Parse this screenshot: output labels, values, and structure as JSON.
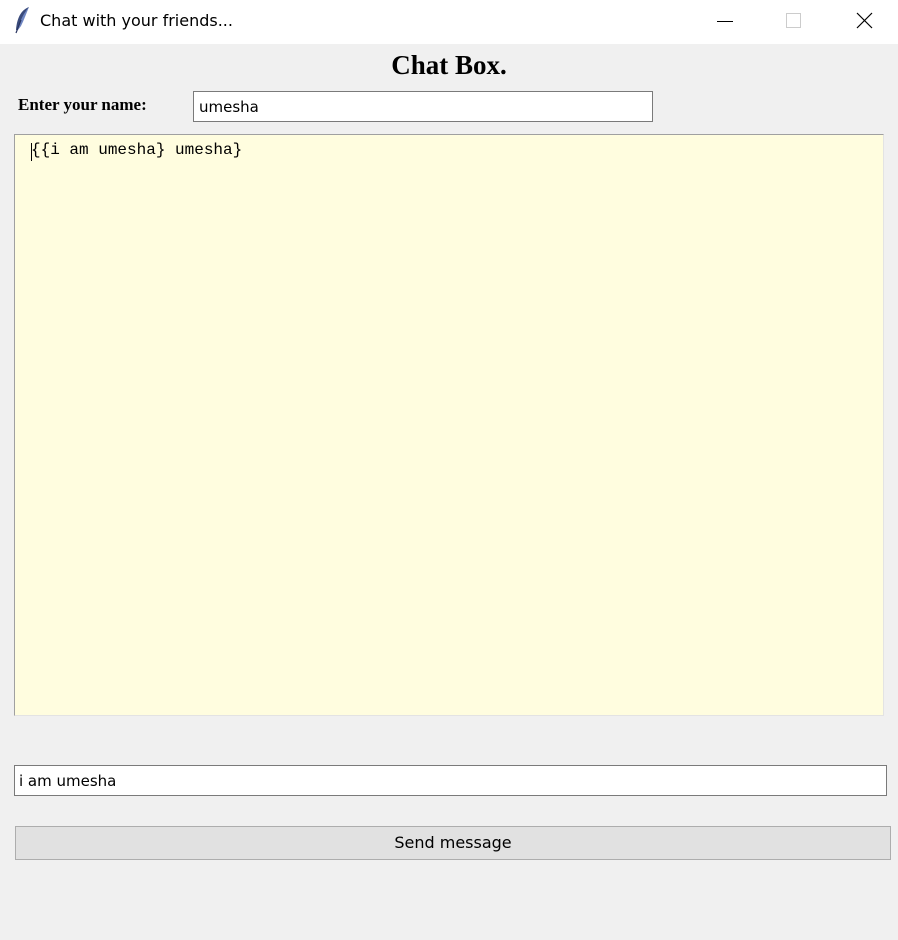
{
  "window": {
    "title": "Chat with your friends...",
    "app_icon": "feather-icon",
    "controls": {
      "minimize_icon": "minimize-icon",
      "maximize_icon": "maximize-icon",
      "close_icon": "close-icon"
    }
  },
  "header": {
    "title": "Chat Box."
  },
  "name_row": {
    "label": "Enter your name:",
    "value": "umesha"
  },
  "chat_log": {
    "background_color": "#fffddf",
    "lines": [
      "{{i am umesha} umesha}"
    ]
  },
  "composer": {
    "message_value": "i am umesha",
    "send_label": "Send message"
  }
}
